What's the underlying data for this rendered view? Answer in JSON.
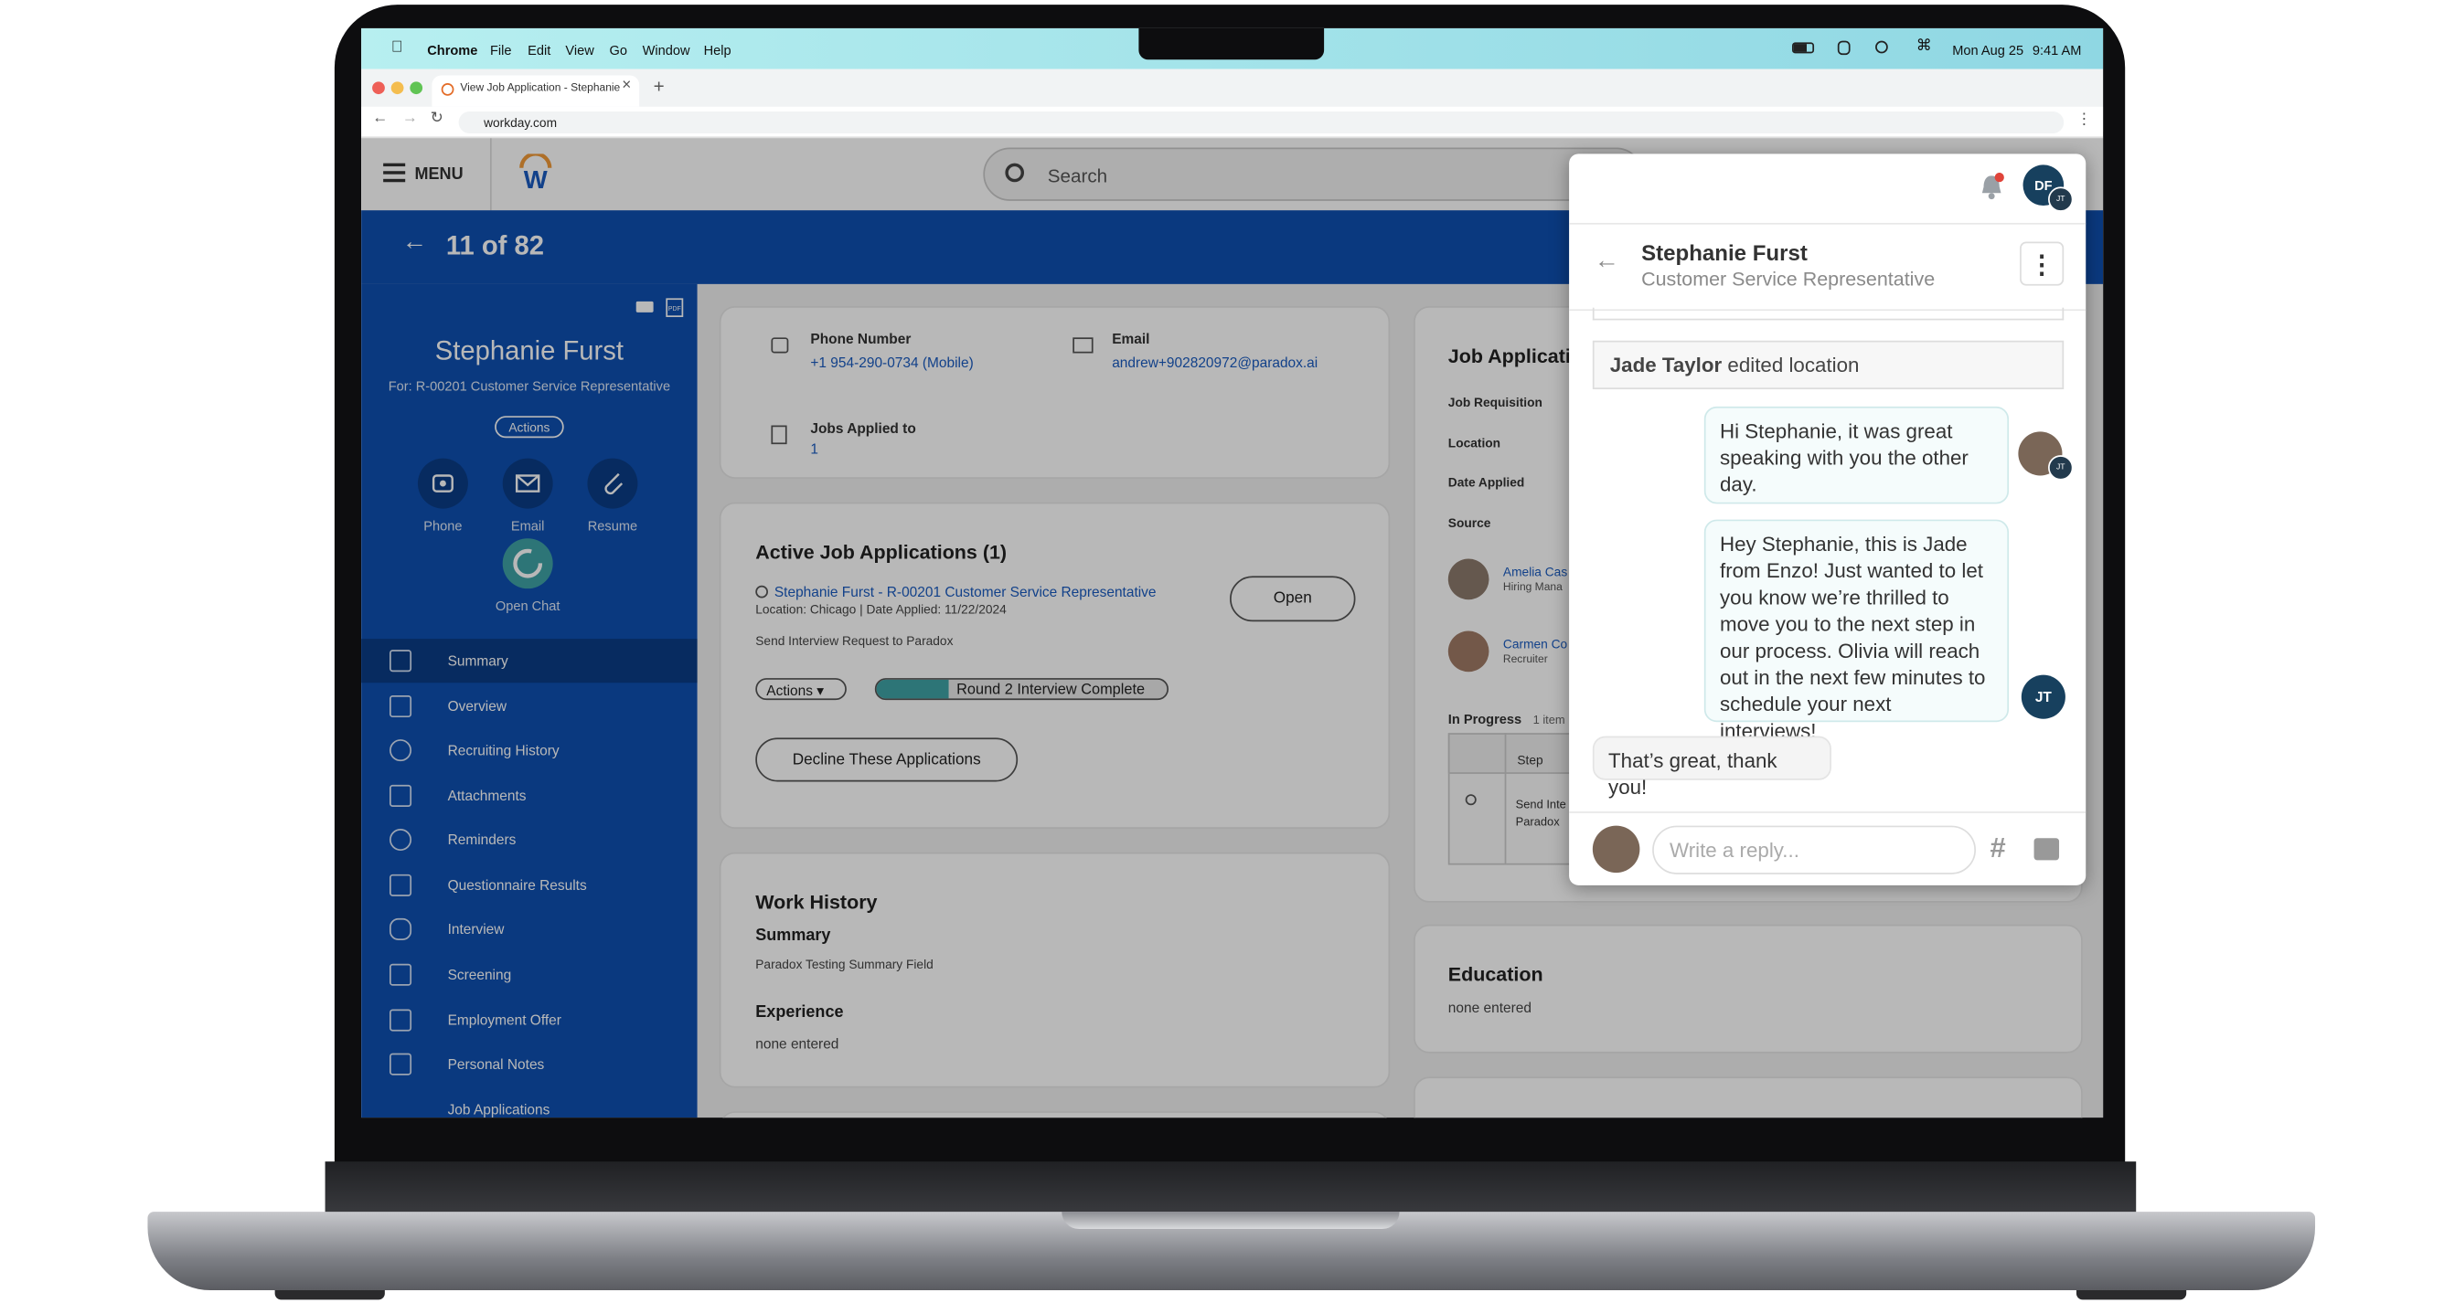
{
  "macos": {
    "app": "Chrome",
    "menus": [
      "File",
      "Edit",
      "View",
      "Go",
      "Window",
      "Help"
    ],
    "date": "Mon Aug 25",
    "time": "9:41 AM"
  },
  "browser": {
    "tab_title": "View Job Application - Stephanie",
    "url": "workday.com"
  },
  "workday": {
    "menu_label": "MENU",
    "search_placeholder": "Search",
    "pager": "11 of 82"
  },
  "candidate": {
    "name": "Stephanie Furst",
    "for": "For: R-00201 Customer Service Representative",
    "actions": "Actions",
    "quick": [
      {
        "label": "Phone"
      },
      {
        "label": "Email"
      },
      {
        "label": "Resume"
      }
    ],
    "open_chat": "Open Chat"
  },
  "nav": [
    "Summary",
    "Overview",
    "Recruiting History",
    "Attachments",
    "Reminders",
    "Questionnaire Results",
    "Interview",
    "Screening",
    "Employment Offer",
    "Personal Notes",
    "Job Applications"
  ],
  "contact": {
    "phone_label": "Phone Number",
    "phone": "+1 954-290-0734 (Mobile)",
    "email_label": "Email",
    "email": "andrew+902820972@paradox.ai",
    "jobs_label": "Jobs Applied to",
    "jobs": "1"
  },
  "active": {
    "title": "Active Job Applications (1)",
    "app_link": "Stephanie Furst - R-00201 Customer Service Representative",
    "meta": "Location: Chicago | Date Applied: 11/22/2024",
    "note": "Send Interview Request to Paradox",
    "open": "Open",
    "actions": "Actions",
    "status": "Round 2 Interview Complete",
    "decline": "Decline These Applications"
  },
  "work": {
    "title": "Work History",
    "summary_label": "Summary",
    "summary": "Paradox Testing Summary Field",
    "exp_label": "Experience",
    "exp": "none entered"
  },
  "jobapp": {
    "title": "Job Applicati",
    "rows": [
      "Job Requisition",
      "Location",
      "Date Applied",
      "Source"
    ],
    "people": [
      {
        "name": "Amelia Cas",
        "role": "Hiring Mana"
      },
      {
        "name": "Carmen Co",
        "role": "Recruiter"
      }
    ],
    "inprogress": "In Progress",
    "items": "1 item",
    "step_col": "Step",
    "step_val1": "Send Inte",
    "step_val2": "Paradox"
  },
  "education": {
    "title": "Education",
    "value": "none entered"
  },
  "chat": {
    "header_initials": "DF",
    "badge": "JT",
    "name": "Stephanie Furst",
    "role": "Customer Service Representative",
    "event_actor": "Jade Taylor",
    "event_text": " edited location",
    "msg1": "Hi Stephanie, it was great speaking with you the other day.",
    "msg2": "Hey Stephanie, this is Jade from Enzo! Just wanted to let you know we’re thrilled to move you to the next step in our process. Olivia will reach out in the next few minutes to schedule your next interviews!",
    "jt": "JT",
    "reply": "That’s great, thank you!",
    "placeholder": "Write a reply..."
  },
  "colors": {
    "brand_blue": "#0f50b0",
    "teal": "#3fa3a6",
    "notif": "#e0443a"
  }
}
